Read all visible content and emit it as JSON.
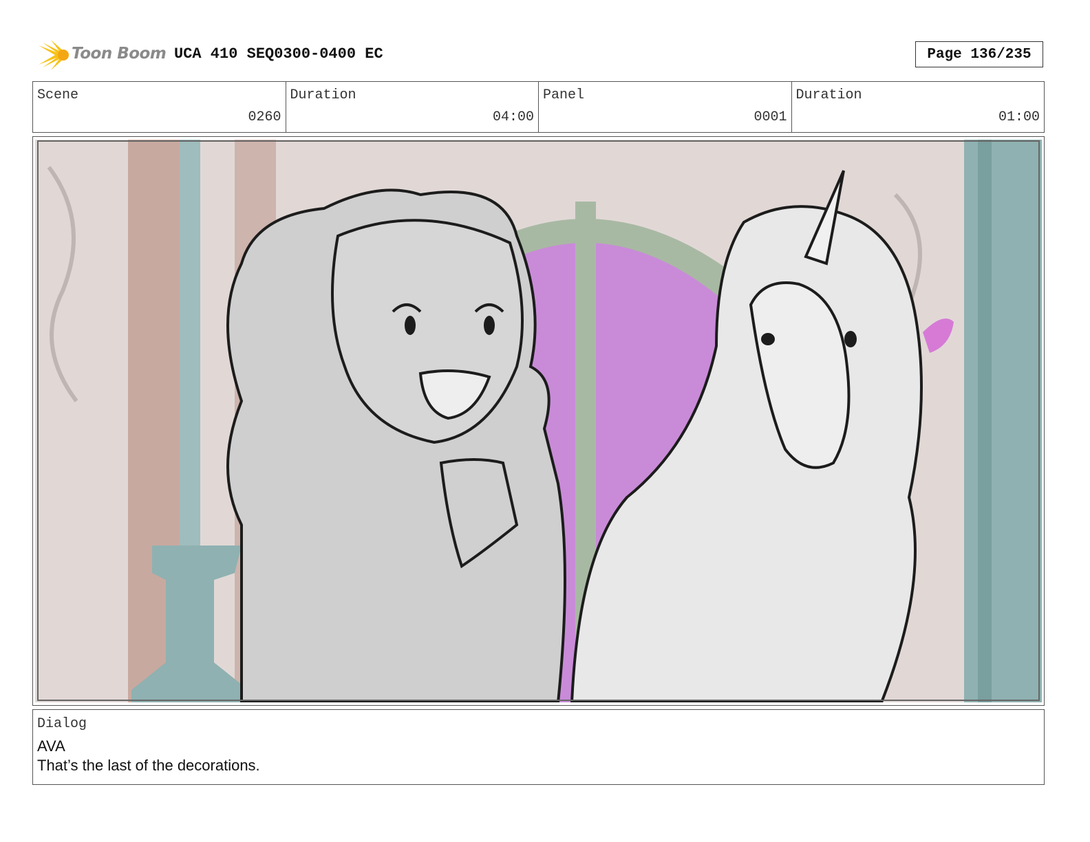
{
  "header": {
    "logo_text": "Toon Boom",
    "title": "UCA 410 SEQ0300-0400 EC",
    "page": "Page 136/235"
  },
  "info": [
    {
      "label": "Scene",
      "value": "0260"
    },
    {
      "label": "Duration",
      "value": "04:00"
    },
    {
      "label": "Panel",
      "value": "0001"
    },
    {
      "label": "Duration",
      "value": "01:00"
    }
  ],
  "dialog": {
    "label": "Dialog",
    "speaker": "AVA",
    "line": "That’s the last of the decorations."
  },
  "colors": {
    "logo_accent": "#f7c21a",
    "window_magenta": "#c98bd8",
    "wall_pink": "#d7c7c4",
    "teal_column": "#7fa6a6"
  }
}
